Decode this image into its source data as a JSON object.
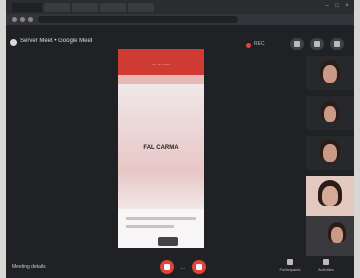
{
  "meeting": {
    "title": "Server Meet • Google Meet",
    "recording_label": "REC",
    "shared_caption": "... ... .....",
    "shared_center_text": "FAL CARMA",
    "details_label": "Meeting details"
  },
  "participants": [
    {
      "name": ""
    },
    {
      "name": ""
    },
    {
      "name": ""
    },
    {
      "name": ""
    },
    {
      "name": ""
    }
  ],
  "controls": {
    "center_text": "..."
  },
  "actions": [
    {
      "label": "Participants"
    },
    {
      "label": "Activities"
    }
  ],
  "colors": {
    "background": "#202124",
    "accent_red": "#e0443a",
    "shared_header": "#cf3b33"
  }
}
